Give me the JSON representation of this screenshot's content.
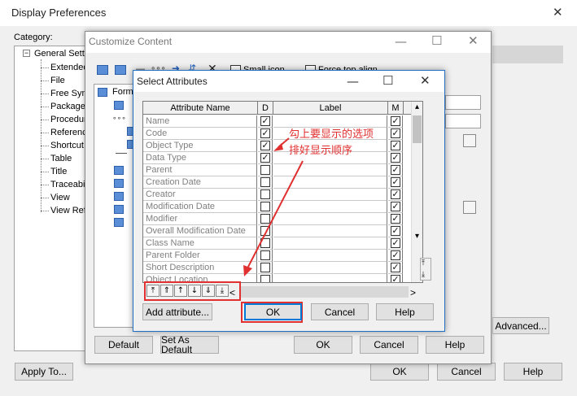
{
  "display_prefs": {
    "title": "Display Preferences",
    "close_glyph": "✕",
    "category_label": "Category:",
    "tree_root": "General Settings",
    "tree_items": [
      "Extended",
      "File",
      "Free Symbol",
      "Package",
      "Procedure",
      "Reference",
      "Shortcut",
      "Table",
      "Title",
      "Traceability",
      "View",
      "View Reference"
    ],
    "buttons": {
      "apply_to": "Apply To...",
      "ok": "OK",
      "cancel": "Cancel",
      "help": "Help"
    }
  },
  "customize_content": {
    "title": "Customize Content",
    "minimize_glyph": "—",
    "maximize_glyph": "☐",
    "close_glyph": "✕",
    "small_icon_label": "Small icon",
    "force_top_align_label": "Force top align",
    "tree_first_item": "Form",
    "buttons": {
      "default": "Default",
      "set_as_default": "Set As Default",
      "ok": "OK",
      "cancel": "Cancel",
      "help": "Help",
      "advanced": "Advanced..."
    }
  },
  "select_attributes": {
    "title": "Select Attributes",
    "minimize_glyph": "—",
    "maximize_glyph": "☐",
    "close_glyph": "✕",
    "columns": {
      "name": "Attribute Name",
      "d": "D",
      "label": "Label",
      "m": "M"
    },
    "rows": [
      {
        "name": "Name",
        "d": true,
        "m": true
      },
      {
        "name": "Code",
        "d": true,
        "m": true
      },
      {
        "name": "Object Type",
        "d": true,
        "m": true
      },
      {
        "name": "Data Type",
        "d": true,
        "m": true
      },
      {
        "name": "Parent",
        "d": false,
        "m": true
      },
      {
        "name": "Creation Date",
        "d": false,
        "m": true
      },
      {
        "name": "Creator",
        "d": false,
        "m": true
      },
      {
        "name": "Modification Date",
        "d": false,
        "m": true
      },
      {
        "name": "Modifier",
        "d": false,
        "m": true
      },
      {
        "name": "Overall Modification Date",
        "d": false,
        "m": true
      },
      {
        "name": "Class Name",
        "d": false,
        "m": true
      },
      {
        "name": "Parent Folder",
        "d": false,
        "m": true
      },
      {
        "name": "Short Description",
        "d": false,
        "m": true
      },
      {
        "name": "Object Location",
        "d": false,
        "m": true
      }
    ],
    "check_glyph": "✓",
    "move_buttons": [
      "⤒",
      "⇑",
      "↑",
      "↓",
      "⇓",
      "⤓"
    ],
    "scroll_left_glyph": "<",
    "scroll_right_glyph": ">",
    "scroll_up_glyph": "▴",
    "scroll_down_glyph": "▾",
    "buttons": {
      "add_attribute": "Add attribute...",
      "ok": "OK",
      "cancel": "Cancel",
      "help": "Help"
    }
  },
  "annotation": {
    "line1": "勾上要显示的选项",
    "line2": "排好显示顺序",
    "color": "#e03030"
  }
}
